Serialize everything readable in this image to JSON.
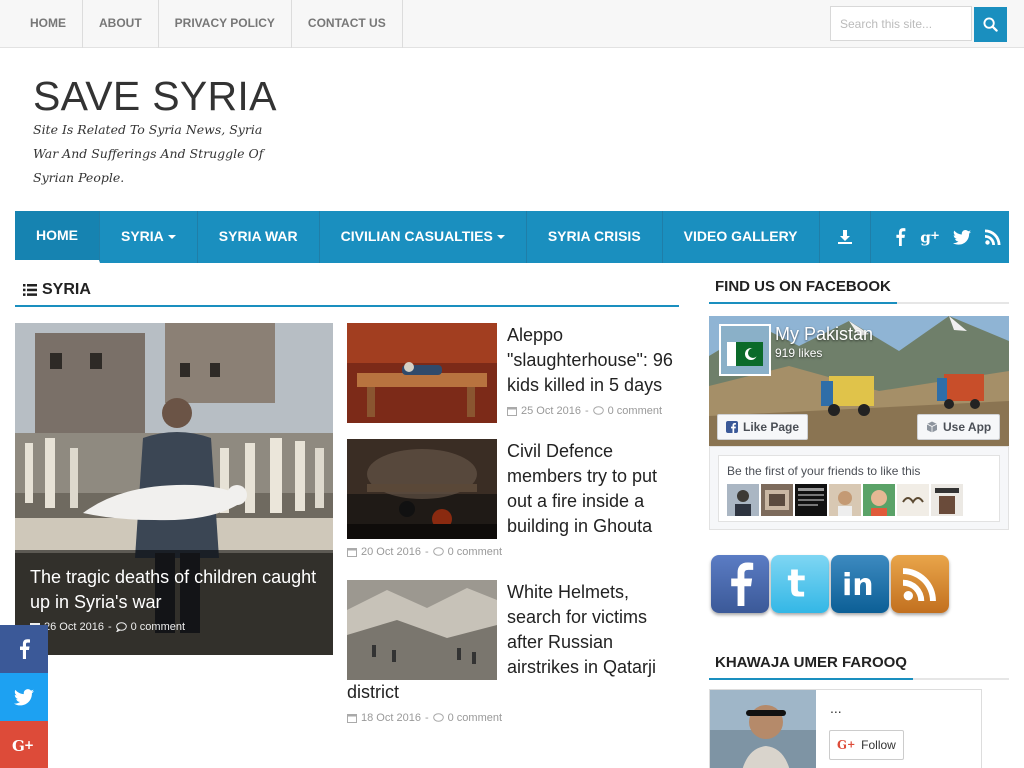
{
  "topnav": {
    "items": [
      "HOME",
      "ABOUT",
      "PRIVACY POLICY",
      "CONTACT US"
    ],
    "search_placeholder": "Search this site..."
  },
  "header": {
    "title": "SAVE SYRIA",
    "description": "Site Is Related To Syria News, Syria War And Sufferings And Struggle Of Syrian People."
  },
  "mainnav": {
    "items": [
      {
        "label": "HOME"
      },
      {
        "label": "SYRIA"
      },
      {
        "label": "SYRIA WAR"
      },
      {
        "label": "CIVILIAN CASUALTIES"
      },
      {
        "label": "SYRIA CRISIS"
      },
      {
        "label": "VIDEO GALLERY"
      }
    ],
    "icons": [
      "download-icon",
      "facebook-icon",
      "google-plus-icon",
      "twitter-icon",
      "rss-icon"
    ],
    "accent": "#1a8fbf"
  },
  "section": {
    "title": "SYRIA"
  },
  "featured": {
    "title": "The tragic deaths of children caught up in Syria's war",
    "date": "26 Oct 2016",
    "comments": "0 comment"
  },
  "posts": [
    {
      "title": "Aleppo \"slaughterhouse\": 96 kids killed in 5 days",
      "date": "25 Oct 2016",
      "comments": "0 comment"
    },
    {
      "title": "Civil Defence members try to put out a fire inside a building in Ghouta",
      "date": "20 Oct 2016",
      "comments": "0 comment"
    },
    {
      "title_main": "White Helmets, search for victims after Russian airstrikes in Qatarji",
      "title_tail": "district",
      "date": "18 Oct 2016",
      "comments": "0 comment"
    }
  ],
  "sidebar": {
    "facebook_heading": "FIND US ON FACEBOOK",
    "fb_page_name": "My Pakistan",
    "fb_likes": "919 likes",
    "fb_like_btn": "Like Page",
    "fb_use_app": "Use App",
    "fb_friends_text": "Be the first of your friends to like this",
    "social_icons": [
      "facebook-icon",
      "twitter-icon",
      "linkedin-icon",
      "rss-icon"
    ],
    "profile_heading": "KHAWAJA UMER FAROOQ",
    "profile_name": "...",
    "follow_label": "Follow"
  },
  "share_bar": [
    "facebook-icon",
    "twitter-icon",
    "google-plus-icon"
  ],
  "date_sep": "-"
}
